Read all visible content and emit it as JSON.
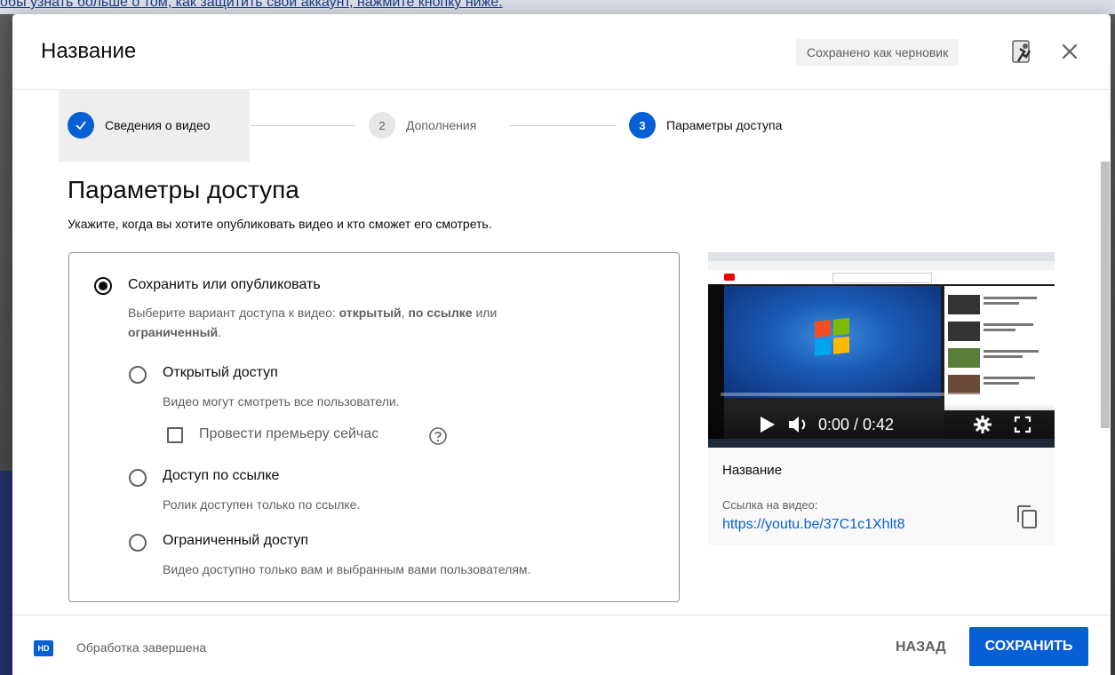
{
  "background": {
    "notice_text": "обы узнать больше о том, как защитить свой аккаунт, нажмите кнопку ниже."
  },
  "header": {
    "title": "Название",
    "draft_status": "Сохранено как черновик",
    "feedback_icon": "feedback-icon",
    "close_icon": "close-icon"
  },
  "stepper": {
    "steps": [
      {
        "label": "Сведения о видео",
        "state": "done",
        "marker": "✓"
      },
      {
        "label": "Дополнения",
        "state": "pending",
        "marker": "2"
      },
      {
        "label": "Параметры доступа",
        "state": "current",
        "marker": "3"
      }
    ]
  },
  "visibility": {
    "heading": "Параметры доступа",
    "subtitle": "Укажите, когда вы хотите опубликовать видео и кто сможет его смотреть.",
    "save_or_publish": {
      "title": "Сохранить или опубликовать",
      "desc_prefix": "Выберите вариант доступа к видео: ",
      "desc_public": "открытый",
      "desc_sep": ", ",
      "desc_unlisted": "по ссылке",
      "desc_or": " или ",
      "desc_private": "ограниченный",
      "desc_end": ".",
      "selected": true
    },
    "options": [
      {
        "title": "Открытый доступ",
        "desc": "Видео могут смотреть все пользователи.",
        "selected": false
      },
      {
        "title": "Доступ по ссылке",
        "desc": "Ролик доступен только по ссылке.",
        "selected": false
      },
      {
        "title": "Ограниченный доступ",
        "desc": "Видео доступно только вам и выбранным вами пользователям.",
        "selected": false
      }
    ],
    "premiere": {
      "label": "Провести премьеру сейчас",
      "checked": false
    }
  },
  "preview": {
    "time": "0:00 / 0:42",
    "title_label": "Название",
    "link_label": "Ссылка на видео:",
    "link": "https://youtu.be/37C1c1Xhlt8"
  },
  "footer": {
    "hd_badge": "HD",
    "status": "Обработка завершена",
    "back_label": "НАЗАД",
    "save_label": "СОХРАНИТЬ"
  },
  "colors": {
    "accent": "#065fd4",
    "muted_text": "#606060",
    "text": "#0d0d0d"
  }
}
